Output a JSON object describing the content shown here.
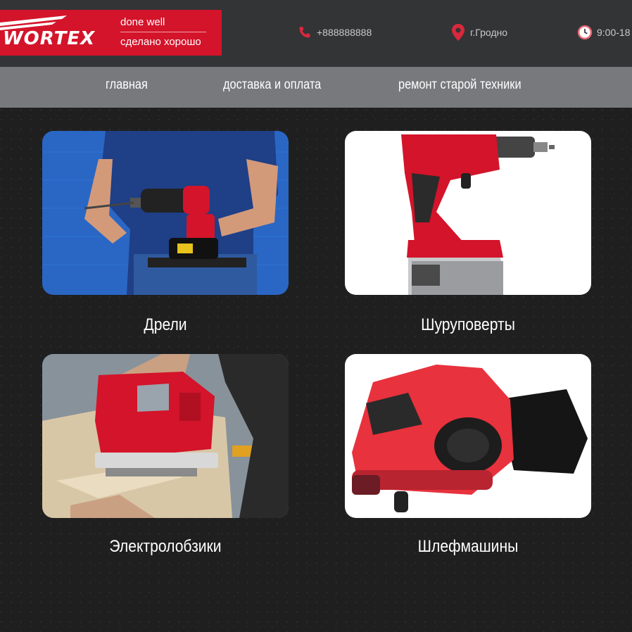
{
  "header": {
    "logo": {
      "brand": "WORTEX",
      "tagline_en": "done well",
      "tagline_ru": "сделано хорошо"
    },
    "contacts": {
      "phone": "+888888888",
      "city": "г.Гродно",
      "hours": "9:00-18"
    },
    "icons": {
      "phone": "phone-icon",
      "city": "location-pin-icon",
      "hours": "clock-icon"
    }
  },
  "nav": {
    "items": [
      {
        "label": "главная"
      },
      {
        "label": "доставка и оплата"
      },
      {
        "label": "ремонт старой техники"
      }
    ]
  },
  "categories": [
    {
      "label": "Дрели",
      "image": "hammer-drill-photo"
    },
    {
      "label": "Шуруповерты",
      "image": "cordless-screwdriver-photo"
    },
    {
      "label": "Электролобзики",
      "image": "jigsaw-photo"
    },
    {
      "label": "Шлефмашины",
      "image": "belt-sander-photo"
    }
  ],
  "colors": {
    "brand_red": "#d3142a",
    "header_bg": "#333436",
    "nav_bg": "#77797c",
    "page_bg": "#1f1f20"
  }
}
